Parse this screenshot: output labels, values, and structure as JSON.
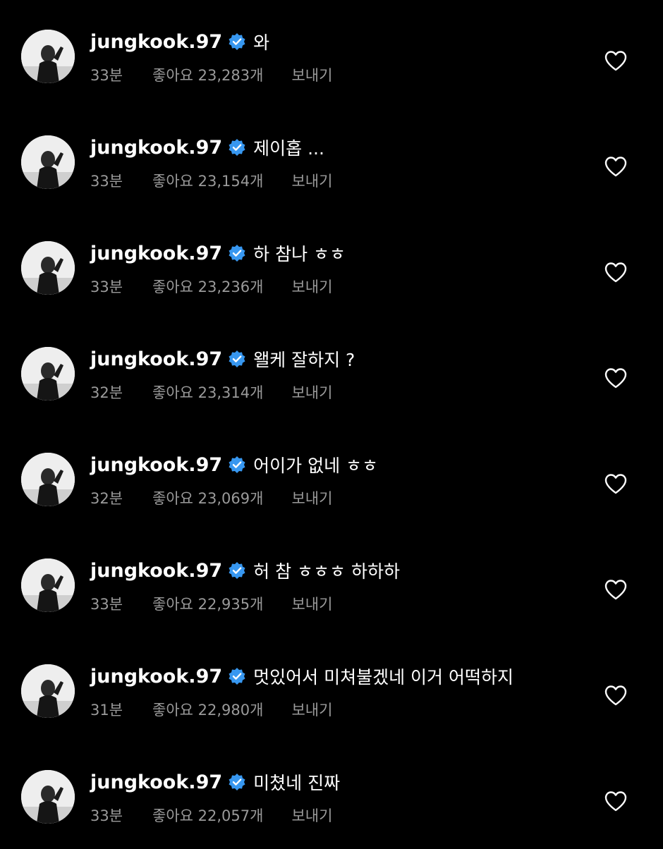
{
  "comments": [
    {
      "username": "jungkook.97",
      "text": "와",
      "time": "33분",
      "likes": "좋아요 23,283개",
      "reply": "보내기"
    },
    {
      "username": "jungkook.97",
      "text": "제이홉 ...",
      "time": "33분",
      "likes": "좋아요 23,154개",
      "reply": "보내기"
    },
    {
      "username": "jungkook.97",
      "text": "하 참나 ㅎㅎ",
      "time": "33분",
      "likes": "좋아요 23,236개",
      "reply": "보내기"
    },
    {
      "username": "jungkook.97",
      "text": "왤케 잘하지 ?",
      "time": "32분",
      "likes": "좋아요 23,314개",
      "reply": "보내기"
    },
    {
      "username": "jungkook.97",
      "text": "어이가 없네 ㅎㅎ",
      "time": "32분",
      "likes": "좋아요 23,069개",
      "reply": "보내기"
    },
    {
      "username": "jungkook.97",
      "text": "허 참 ㅎㅎㅎ 하하하",
      "time": "33분",
      "likes": "좋아요 22,935개",
      "reply": "보내기"
    },
    {
      "username": "jungkook.97",
      "text": "멋있어서 미쳐불겠네 이거 어떡하지",
      "time": "31분",
      "likes": "좋아요 22,980개",
      "reply": "보내기"
    },
    {
      "username": "jungkook.97",
      "text": "미쳤네 진짜",
      "time": "33분",
      "likes": "좋아요 22,057개",
      "reply": "보내기"
    }
  ],
  "icons": {
    "verified": "verified-badge-icon",
    "like": "heart-outline-icon"
  },
  "colors": {
    "background": "#000000",
    "username": "#ffffff",
    "meta": "#9a9a9a",
    "verified": "#3797f0"
  }
}
